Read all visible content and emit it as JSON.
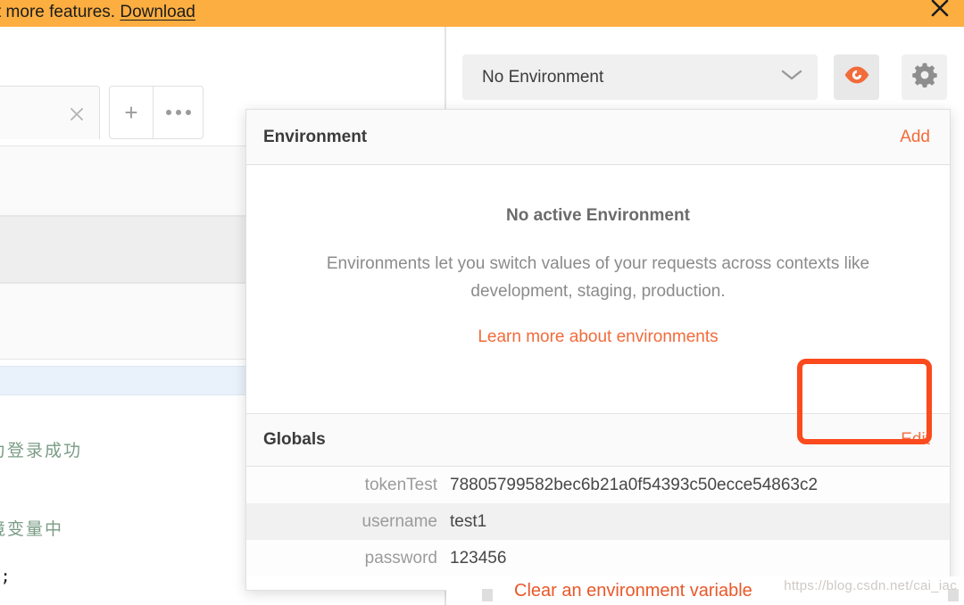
{
  "banner": {
    "text_before_link": "t more features. ",
    "link_label": "Download",
    "close_icon": "close-icon",
    "background": "#FCAE41"
  },
  "left_pane": {
    "tab_close_icon": "close-icon",
    "new_tab_label": "+",
    "more_actions_icon": "ellipsis-icon",
    "code_lines": [
      "认为登录成功",
      "环境变量中",
      "en);"
    ]
  },
  "toolbar": {
    "environment_selector": {
      "value": "No Environment",
      "chevron_icon": "chevron-down-icon"
    },
    "quick_look_icon": "eye-icon",
    "settings_icon": "gear-icon"
  },
  "environment_panel": {
    "header": {
      "title": "Environment",
      "add_label": "Add"
    },
    "empty_state": {
      "title": "No active Environment",
      "description": "Environments let you switch values of your requests across contexts like development, staging, production.",
      "link_label": "Learn more about environments"
    },
    "globals": {
      "title": "Globals",
      "edit_label": "Edit",
      "variables": [
        {
          "key": "tokenTest",
          "value": "78805799582bec6b21a0f54393c50ecce54863c2"
        },
        {
          "key": "username",
          "value": "test1"
        },
        {
          "key": "password",
          "value": "123456"
        }
      ]
    }
  },
  "annotation": {
    "highlight_color": "#FB4A1D",
    "target": "globals-edit-button"
  },
  "bottom": {
    "snippet_label": "Clear an environment variable",
    "watermark": "https://blog.csdn.net/cai_iac"
  }
}
